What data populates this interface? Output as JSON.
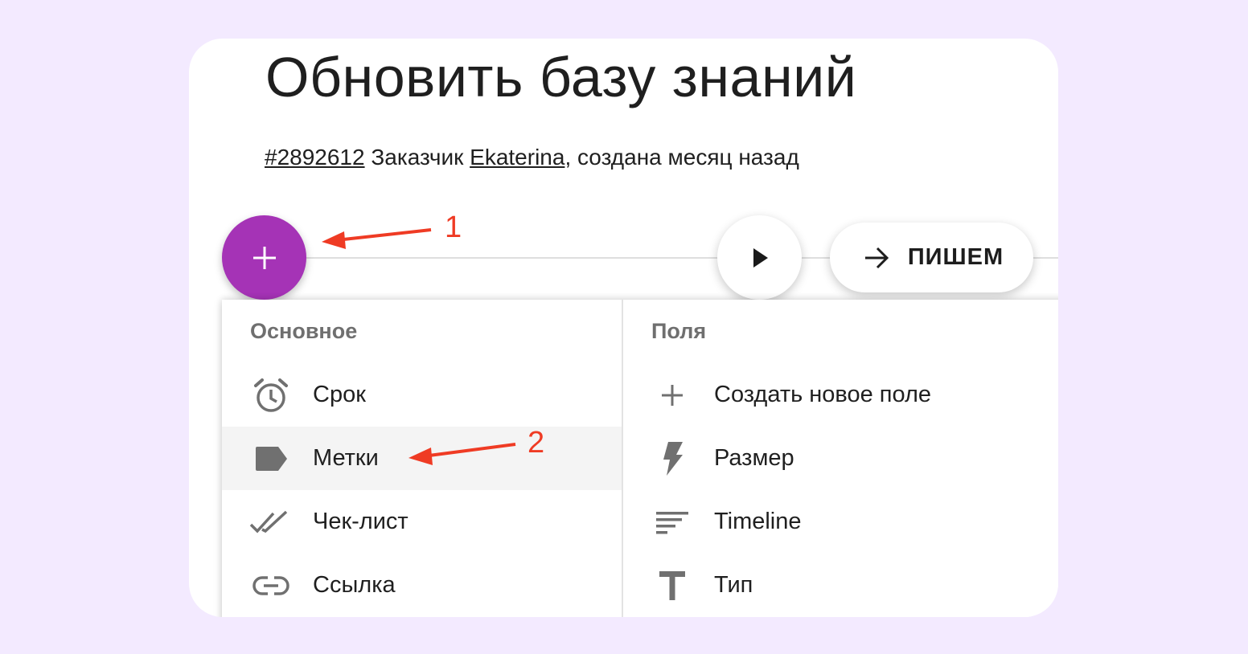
{
  "task": {
    "title": "Обновить базу знаний",
    "id_link": "#2892612",
    "customer_prefix": " Заказчик ",
    "customer_name": "Ekaterina",
    "created_text": ", создана месяц назад"
  },
  "toolbar": {
    "stage_label": "ПИШЕМ"
  },
  "menu": {
    "main_section": {
      "title": "Основное",
      "items": [
        {
          "label": "Срок",
          "icon": "alarm-clock-icon"
        },
        {
          "label": "Метки",
          "icon": "label-tag-icon"
        },
        {
          "label": "Чек-лист",
          "icon": "double-check-icon"
        },
        {
          "label": "Ссылка",
          "icon": "link-icon"
        }
      ]
    },
    "fields_section": {
      "title": "Поля",
      "items": [
        {
          "label": "Создать новое поле",
          "icon": "plus-icon"
        },
        {
          "label": "Размер",
          "icon": "lightning-icon"
        },
        {
          "label": "Timeline",
          "icon": "text-lines-icon"
        },
        {
          "label": "Тип",
          "icon": "text-type-icon"
        }
      ]
    }
  },
  "annotations": {
    "first": "1",
    "second": "2"
  },
  "colors": {
    "background": "#f3eaff",
    "fab": "#a533b6",
    "arrow": "#ef3b24"
  }
}
